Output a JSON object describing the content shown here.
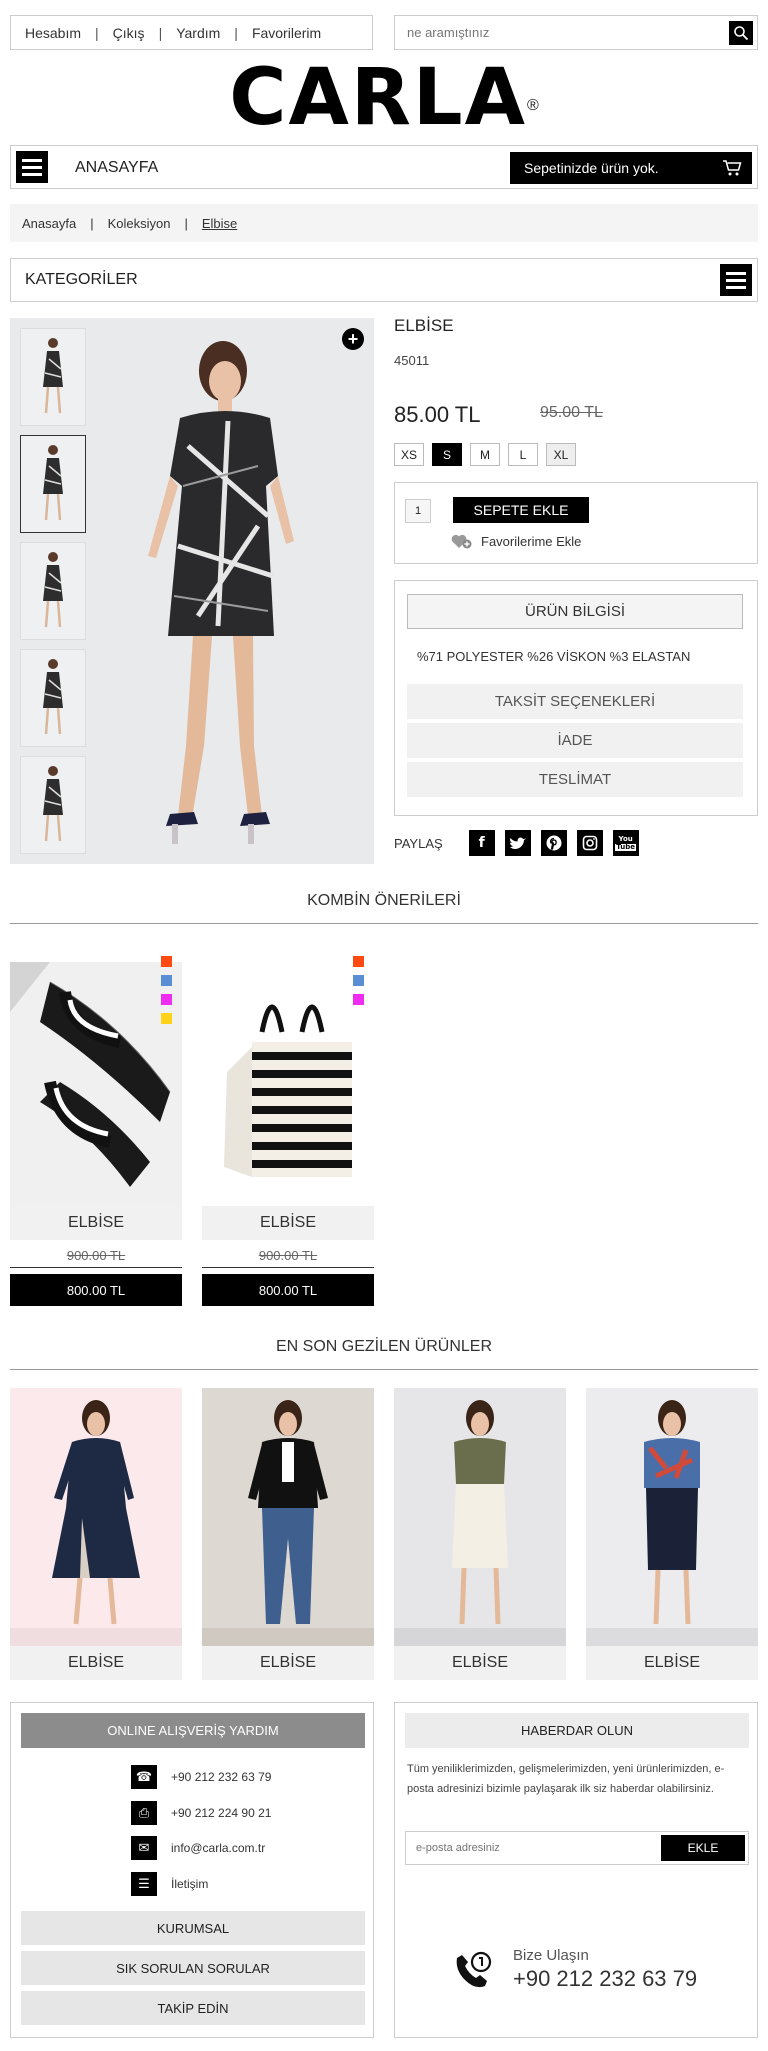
{
  "header": {
    "links": [
      "Hesabım",
      "Çıkış",
      "Yardım",
      "Favorilerim"
    ],
    "search_placeholder": "ne aramıştınız",
    "logo": "CARLA",
    "logo_mark": "®"
  },
  "nav": {
    "home_label": "ANASAYFA",
    "cart_label": "Sepetinizde ürün yok."
  },
  "breadcrumb": [
    "Anasayfa",
    "Koleksiyon",
    "Elbise"
  ],
  "categories_label": "KATEGORİLER",
  "product": {
    "name": "ELBİSE",
    "code": "45011",
    "price": "85.00 TL",
    "old_price": "95.00 TL",
    "sizes": [
      "XS",
      "S",
      "M",
      "L",
      "XL"
    ],
    "selected_size": "S",
    "quantity": "1",
    "add_to_cart": "SEPETE EKLE",
    "add_favorite": "Favorilerime Ekle",
    "info_tab": "ÜRÜN BİLGİSİ",
    "material": "%71 POLYESTER %26 VİSKON %3 ELASTAN",
    "tabs": [
      "TAKSİT SEÇENEKLERİ",
      "İADE",
      "TESLİMAT"
    ],
    "share_label": "PAYLAŞ"
  },
  "social": [
    "facebook",
    "twitter",
    "pinterest",
    "instagram",
    "youtube"
  ],
  "combo": {
    "title": "KOMBİN ÖNERİLERİ",
    "items": [
      {
        "name": "ELBİSE",
        "old_price": "900.00 TL",
        "price": "800.00 TL",
        "swatches": [
          "#ff4a12",
          "#5a8fd6",
          "#ee2df0",
          "#ffd21a"
        ]
      },
      {
        "name": "ELBİSE",
        "old_price": "900.00 TL",
        "price": "800.00 TL",
        "swatches": [
          "#ff4a12",
          "#5a8fd6",
          "#ee2df0"
        ]
      }
    ]
  },
  "recent": {
    "title": "EN SON GEZİLEN ÜRÜNLER",
    "items": [
      {
        "name": "ELBİSE"
      },
      {
        "name": "ELBİSE"
      },
      {
        "name": "ELBİSE"
      },
      {
        "name": "ELBİSE"
      }
    ]
  },
  "help": {
    "title": "ONLINE ALIŞVERİŞ YARDIM",
    "phone": "+90 212 232 63 79",
    "fax": "+90 212 224 90 21",
    "email": "info@carla.com.tr",
    "contact": "İletişim",
    "buttons": [
      "KURUMSAL",
      "SIK SORULAN SORULAR",
      "TAKİP EDİN"
    ]
  },
  "newsletter": {
    "title": "HABERDAR OLUN",
    "text": "Tüm yeniliklerimizden, gelişmelerimizden, yeni ürünlerimizden, e-posta adresinizi bizimle paylaşarak ilk siz haberdar olabilirsiniz.",
    "placeholder": "e-posta adresiniz",
    "button": "EKLE",
    "call_label": "Bize Ulaşın",
    "call_number": "+90 212 232 63 79"
  },
  "colors": {
    "accent": "#000000",
    "muted_bg": "#f1f1f1"
  }
}
